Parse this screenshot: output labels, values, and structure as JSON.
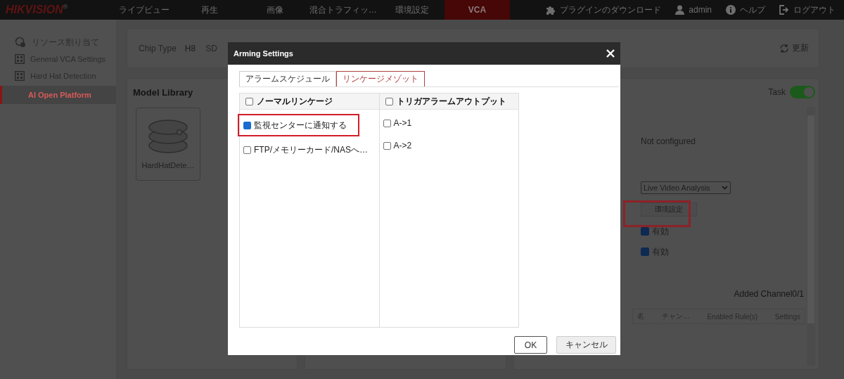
{
  "top_nav": {
    "logo": "HIKVISION",
    "logo_mark": "®",
    "items": [
      {
        "label": "ライブビュー",
        "selected": false
      },
      {
        "label": "再生",
        "selected": false
      },
      {
        "label": "画像",
        "selected": false
      },
      {
        "label": "混合トラフィッ…",
        "selected": false
      },
      {
        "label": "環境設定",
        "selected": false
      },
      {
        "label": "VCA",
        "selected": true
      }
    ],
    "actions": [
      {
        "kind": "plugin",
        "label": "プラグインのダウンロード"
      },
      {
        "kind": "user",
        "label": "admin"
      },
      {
        "kind": "help",
        "label": "ヘルプ"
      },
      {
        "kind": "logout",
        "label": "ログアウト"
      }
    ]
  },
  "sidebar": {
    "items": [
      {
        "kind": "resource",
        "label": "リソース割り当て",
        "selected": false
      },
      {
        "kind": "module",
        "label": "General VCA Settings",
        "selected": false
      },
      {
        "kind": "module",
        "label": "Hard Hat Detection",
        "selected": false
      },
      {
        "kind": "sub",
        "label": "AI Open Platform",
        "selected": true
      }
    ]
  },
  "info_bar": {
    "chip_type_label": "Chip Type",
    "chip_type": "H8",
    "field_3": "SD",
    "refresh": "更新"
  },
  "model_library": {
    "title": "Model Library",
    "models": [
      {
        "name": "HardHatDete…"
      }
    ]
  },
  "task_panel": {
    "task_label": "Task",
    "task_on": true,
    "status": "Not configured",
    "mode_select": "Live Video Analysis",
    "settings_button": "環境設定",
    "enable_options": [
      {
        "label": "有効",
        "checked": true
      },
      {
        "label": "有効",
        "checked": true
      }
    ],
    "channel_count": "Added Channel0/1",
    "columns": [
      "名",
      "チャン…",
      "Enabled Rule(s)",
      "Settings"
    ]
  },
  "dialog": {
    "title": "Arming Settings",
    "tabs": [
      {
        "label": "アラームスケジュール",
        "selected": false
      },
      {
        "label": "リンケージメゾット",
        "selected": true
      }
    ],
    "groups": [
      {
        "label": "ノーマルリンケージ",
        "checked": false,
        "options": [
          {
            "label": "監視センターに通知する",
            "checked": true,
            "highlighted": true
          },
          {
            "label": "FTP/メモリーカード/NASへ…",
            "checked": false,
            "highlighted": false
          }
        ]
      },
      {
        "label": "トリガアラームアウトプット",
        "checked": false,
        "options": [
          {
            "label": "A->1",
            "checked": false
          },
          {
            "label": "A->2",
            "checked": false
          }
        ]
      }
    ],
    "buttons": [
      {
        "label": "OK",
        "kind": "primary"
      },
      {
        "label": "キャンセル",
        "kind": "secondary"
      }
    ]
  }
}
